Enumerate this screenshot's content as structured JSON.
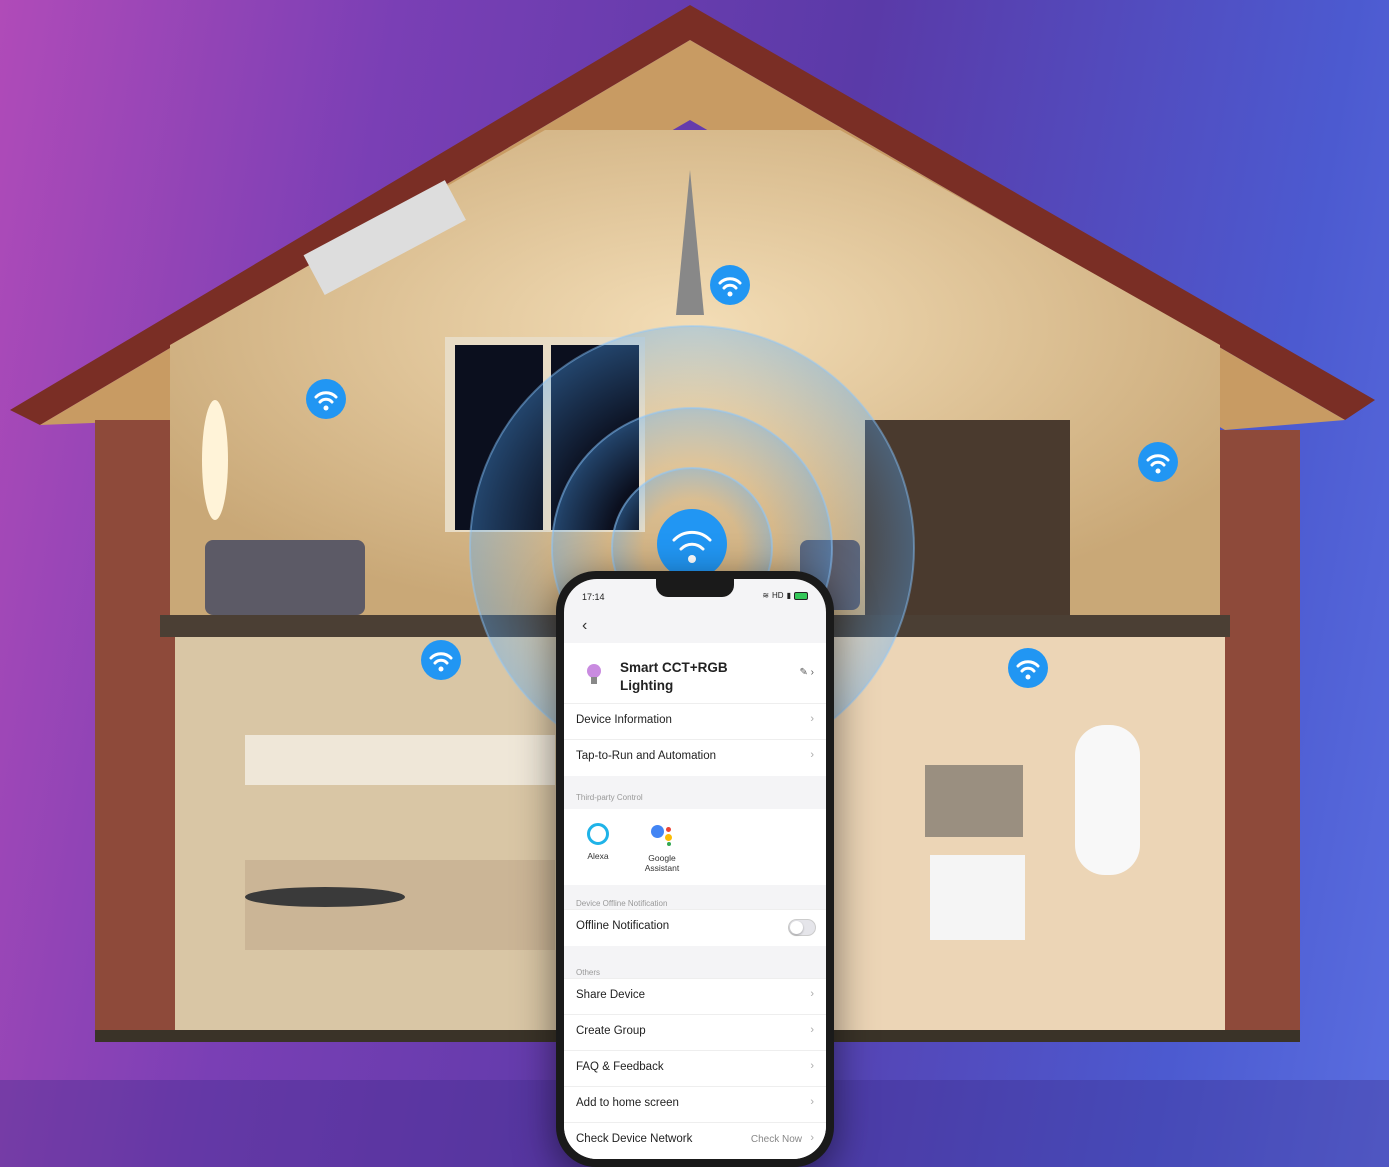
{
  "phone": {
    "status_time": "17:14",
    "status_icons": "HD",
    "device_name": "Smart CCT+RGB Lighting",
    "rows_top": [
      {
        "label": "Device Information"
      },
      {
        "label": "Tap-to-Run and Automation"
      }
    ],
    "third_party": {
      "section": "Third-party Control",
      "items": [
        {
          "label": "Alexa",
          "icon": "alexa-icon"
        },
        {
          "label": "Google Assistant",
          "icon": "google-assistant-icon"
        }
      ]
    },
    "offline": {
      "section": "Device Offline Notification",
      "label": "Offline Notification",
      "enabled": false
    },
    "others": {
      "section": "Others",
      "rows": [
        {
          "label": "Share Device"
        },
        {
          "label": "Create Group"
        },
        {
          "label": "FAQ & Feedback"
        },
        {
          "label": "Add to home screen"
        },
        {
          "label": "Check Device Network",
          "value": "Check Now"
        }
      ]
    }
  },
  "colors": {
    "wifi_badge": "#2196f3",
    "bg_left": "#b04bb8",
    "bg_right": "#5a6ee0"
  }
}
